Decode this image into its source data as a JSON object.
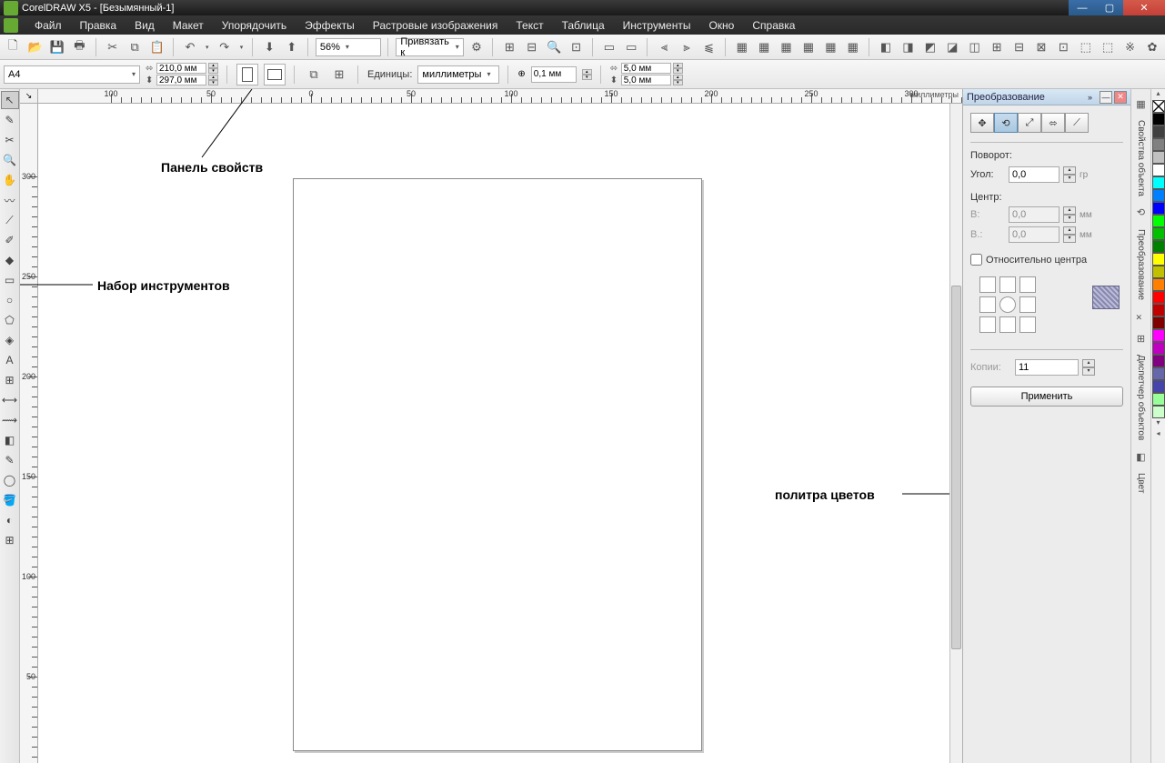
{
  "titlebar": {
    "text": "CorelDRAW X5 - [Безымянный-1]"
  },
  "menu": {
    "items": [
      "Файл",
      "Правка",
      "Вид",
      "Макет",
      "Упорядочить",
      "Эффекты",
      "Растровые изображения",
      "Текст",
      "Таблица",
      "Инструменты",
      "Окно",
      "Справка"
    ]
  },
  "toolbar": {
    "zoom": "56%",
    "snap_label": "Привязать к"
  },
  "propbar": {
    "paper": "A4",
    "width": "210,0 мм",
    "height": "297,0 мм",
    "units_label": "Единицы:",
    "units_value": "миллиметры",
    "nudge": "0,1 мм",
    "dup_x": "5,0 мм",
    "dup_y": "5,0 мм"
  },
  "ruler": {
    "units": "миллиметры",
    "h_labels": [
      "100",
      "50",
      "0",
      "50",
      "100",
      "150",
      "200",
      "250",
      "300"
    ],
    "v_labels": [
      "300",
      "250",
      "200",
      "150",
      "100",
      "50"
    ]
  },
  "annotations": {
    "props": "Панель свойств",
    "tools": "Набор инструментов",
    "palette": "политра цветов"
  },
  "docker": {
    "title": "Преобразование",
    "section_rotate": "Поворот:",
    "angle_label": "Угол:",
    "angle_value": "0,0",
    "angle_unit": "гр",
    "center_label": "Центр:",
    "cx_label": "В:",
    "cx_value": "0,0",
    "cy_label": "В.:",
    "cy_value": "0,0",
    "mm": "мм",
    "relative": "Относительно центра",
    "copies_label": "Копии:",
    "copies_value": "11",
    "apply": "Применить"
  },
  "docker_tabs": {
    "t1": "Свойства объекта",
    "t2": "Преобразование",
    "t3": "Диспетчер объектов",
    "t4": "Цвет"
  },
  "palette_colors": [
    "#000000",
    "#404040",
    "#808080",
    "#c0c0c0",
    "#ffffff",
    "#00ffff",
    "#0080ff",
    "#0000ff",
    "#00ff00",
    "#00c000",
    "#008000",
    "#ffff00",
    "#c0c000",
    "#ff8000",
    "#ff0000",
    "#c00000",
    "#800000",
    "#ff00ff",
    "#c000c0",
    "#800080",
    "#6666aa",
    "#4444aa",
    "#99ff99",
    "#ccffcc"
  ]
}
